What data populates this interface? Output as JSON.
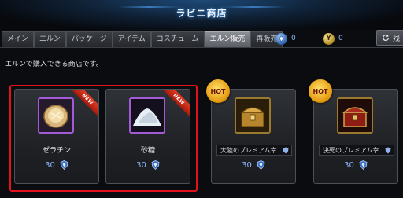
{
  "window": {
    "title": "ラビニ商店"
  },
  "tabs": [
    {
      "label": "メイン",
      "active": false
    },
    {
      "label": "エルン",
      "active": false
    },
    {
      "label": "パッケージ",
      "active": false
    },
    {
      "label": "アイテム",
      "active": false
    },
    {
      "label": "コスチューム",
      "active": false
    },
    {
      "label": "エルン販売",
      "active": true
    },
    {
      "label": "再販売",
      "active": false
    }
  ],
  "currencies": [
    {
      "icon": "blue-gem-icon",
      "value": "0"
    },
    {
      "icon": "gold-coin-icon",
      "symbol": "Y",
      "value": "0"
    }
  ],
  "refresh": {
    "label": "残"
  },
  "description": "エルンで購入できる商店です。",
  "items": [
    {
      "name": "ゼラチン",
      "price": "30",
      "badge": "NEW",
      "icon": "gelatin-plate-icon"
    },
    {
      "name": "砂糖",
      "price": "30",
      "badge": "NEW",
      "icon": "sugar-pile-icon"
    },
    {
      "name": "大陸のプレミアム幸...",
      "price": "30",
      "badge": "HOT",
      "icon": "gold-treasure-chest-icon"
    },
    {
      "name": "決死のプレミアム幸...",
      "price": "30",
      "badge": "HOT",
      "icon": "red-treasure-chest-icon"
    }
  ],
  "colors": {
    "selection_frame": "#e2131d",
    "active_tab": "#7a7e85",
    "price_text": "#8fb8ff",
    "rare_frame": "#a25bd6"
  }
}
